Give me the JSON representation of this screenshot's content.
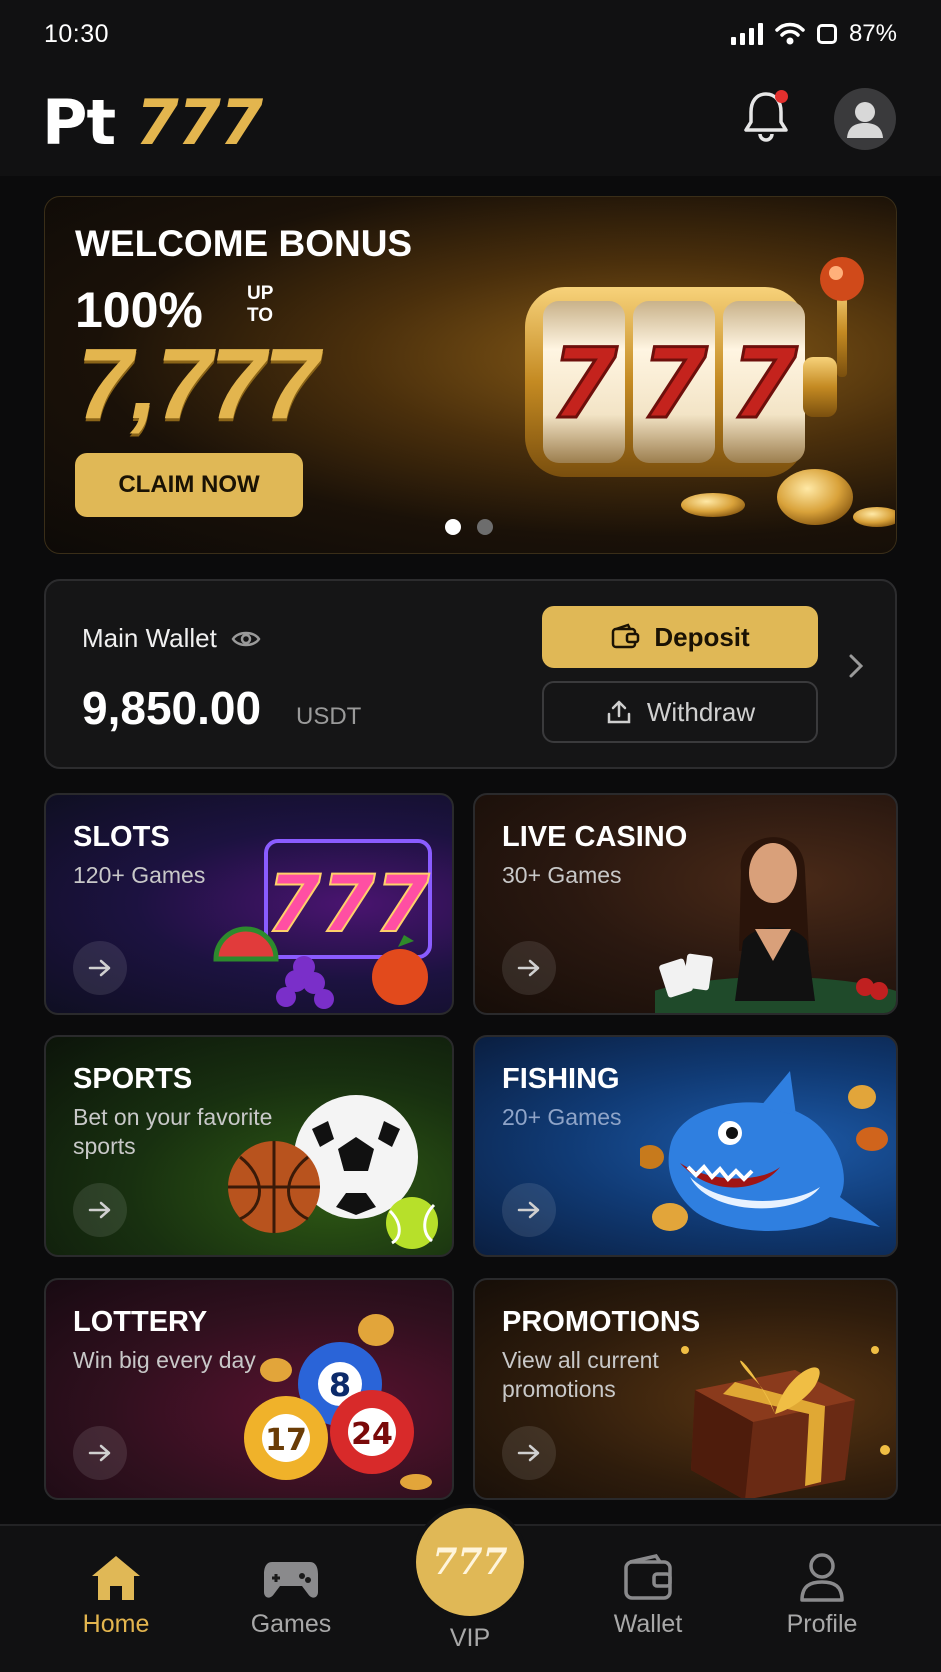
{
  "status_bar": {
    "time": "10:30",
    "battery": "87%"
  },
  "header": {
    "logo_prefix": "Pt",
    "logo_number": "777"
  },
  "banner": {
    "title": "WELCOME BONUS",
    "percent": "100%",
    "up": "UP",
    "to": "TO",
    "amount": "7,777",
    "cta": "CLAIM NOW",
    "slot_digits": [
      "7",
      "7",
      "7"
    ],
    "page_count": 2,
    "active_page": 1
  },
  "wallet": {
    "label": "Main Wallet",
    "amount": "9,850.00",
    "unit": "USDT",
    "deposit": "Deposit",
    "withdraw": "Withdraw"
  },
  "categories": [
    {
      "title": "SLOTS",
      "subtitle": "120+ Games"
    },
    {
      "title": "LIVE CASINO",
      "subtitle": "30+ Games"
    },
    {
      "title": "SPORTS",
      "subtitle": "Bet on your favorite sports"
    },
    {
      "title": "FISHING",
      "subtitle": "20+ Games"
    },
    {
      "title": "LOTTERY",
      "subtitle": "Win big every day"
    },
    {
      "title": "PROMOTIONS",
      "subtitle": "View all current promotions"
    }
  ],
  "art": {
    "slots_sign": "777",
    "lottery_balls": [
      "8",
      "17",
      "24"
    ]
  },
  "nav": {
    "items": [
      {
        "label": "Home",
        "active": true
      },
      {
        "label": "Games"
      },
      {
        "label": "VIP",
        "badge": "777"
      },
      {
        "label": "Wallet"
      },
      {
        "label": "Profile"
      }
    ]
  },
  "colors": {
    "accent": "#e0b856",
    "background": "#0b0b0c",
    "notification": "#e2302e"
  }
}
